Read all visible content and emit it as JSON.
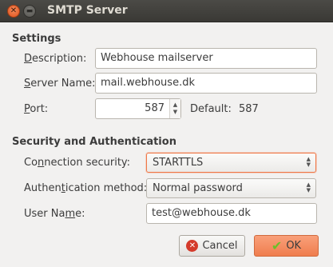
{
  "window": {
    "title": "SMTP Server",
    "close_glyph": "✕",
    "minimize_glyph": "▬"
  },
  "settings": {
    "heading": "Settings",
    "description_label_key": "D",
    "description_label_rest": "escription:",
    "description_value": "Webhouse mailserver",
    "server_label_key": "S",
    "server_label_rest": "erver Name:",
    "server_value": "mail.webhouse.dk",
    "port_label_key": "P",
    "port_label_rest": "ort:",
    "port_value": "587",
    "default_label": "Default:",
    "default_value": "587"
  },
  "security": {
    "heading": "Security and Authentication",
    "connection_label_pre": "Co",
    "connection_label_key": "n",
    "connection_label_rest": "nection security:",
    "connection_value": "STARTTLS",
    "auth_label_pre": "Authen",
    "auth_label_key": "t",
    "auth_label_rest": "ication method:",
    "auth_value": "Normal password",
    "user_label_pre": "User Na",
    "user_label_key": "m",
    "user_label_rest": "e:",
    "user_value": "test@webhouse.dk"
  },
  "buttons": {
    "cancel_label": "Cancel",
    "ok_label": "OK"
  },
  "colors": {
    "accent": "#f07746",
    "titlebar": "#3c3b37"
  },
  "icons": {
    "cancel": "cancel-icon",
    "ok": "checkmark-icon"
  }
}
